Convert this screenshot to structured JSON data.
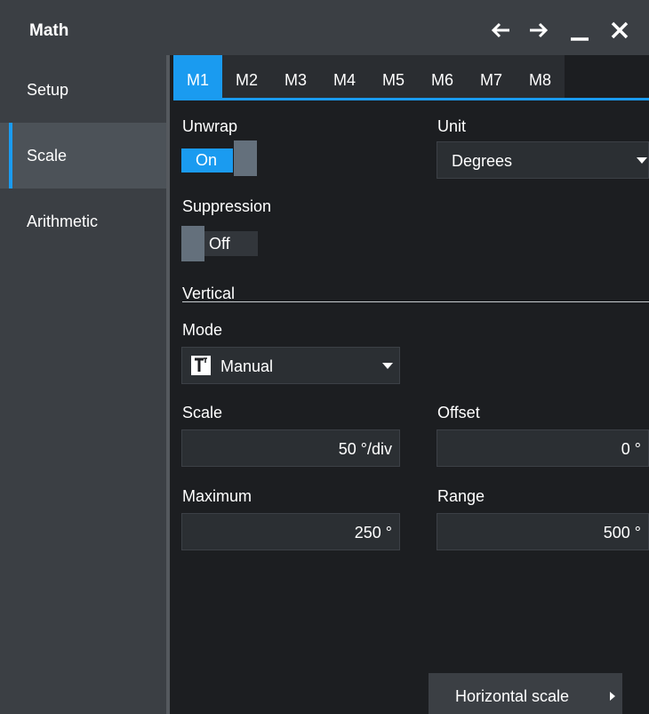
{
  "window": {
    "title": "Math",
    "icons": [
      "arrow-left-icon",
      "arrow-right-icon",
      "minimize-icon",
      "close-icon"
    ]
  },
  "sidebar": {
    "items": [
      {
        "label": "Setup",
        "active": false
      },
      {
        "label": "Scale",
        "active": true
      },
      {
        "label": "Arithmetic",
        "active": false
      }
    ]
  },
  "tabs": [
    {
      "label": "M1",
      "active": true
    },
    {
      "label": "M2",
      "active": false
    },
    {
      "label": "M3",
      "active": false
    },
    {
      "label": "M4",
      "active": false
    },
    {
      "label": "M5",
      "active": false
    },
    {
      "label": "M6",
      "active": false
    },
    {
      "label": "M7",
      "active": false
    },
    {
      "label": "M8",
      "active": false
    }
  ],
  "unwrap": {
    "label": "Unwrap",
    "state": "On"
  },
  "unit": {
    "label": "Unit",
    "value": "Degrees"
  },
  "suppression": {
    "label": "Suppression",
    "state": "Off"
  },
  "vertical": {
    "section_title": "Vertical",
    "mode": {
      "label": "Mode",
      "value": "Manual",
      "icon": "text-cursor-icon"
    },
    "scale": {
      "label": "Scale",
      "value": "50 °/div"
    },
    "offset": {
      "label": "Offset",
      "value": "0 °"
    },
    "maximum": {
      "label": "Maximum",
      "value": "250 °"
    },
    "range": {
      "label": "Range",
      "value": "500 °"
    }
  },
  "footer": {
    "horizontal_scale_label": "Horizontal scale"
  },
  "colors": {
    "accent": "#1a9bf0",
    "panel_bg": "#1c1e21",
    "sidebar_bg": "#3b3f44",
    "field_bg": "#2b2f33"
  }
}
